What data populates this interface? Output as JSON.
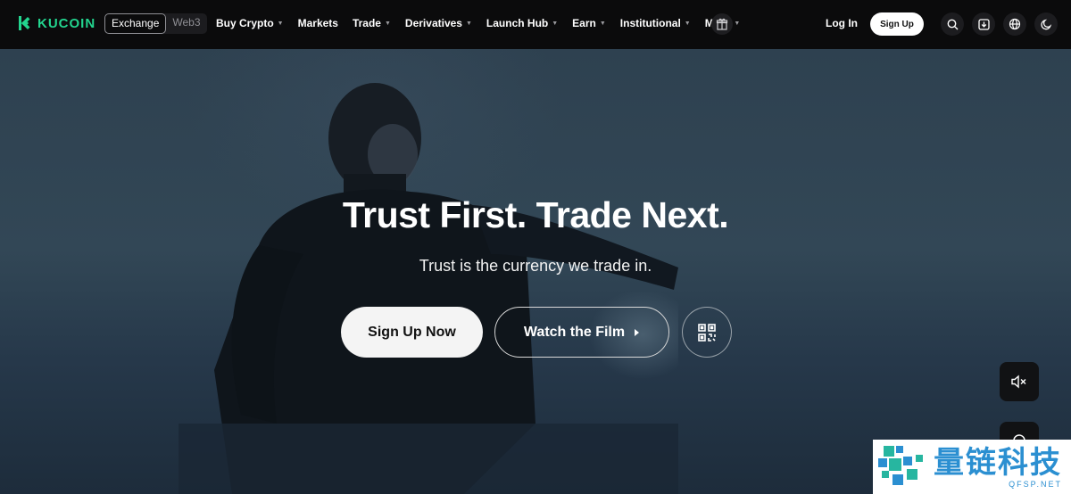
{
  "brand": {
    "name": "KUCOIN",
    "accent": "#23d58f"
  },
  "mode_switch": {
    "items": [
      {
        "label": "Exchange",
        "active": true
      },
      {
        "label": "Web3",
        "active": false
      }
    ]
  },
  "menu": {
    "items": [
      {
        "label": "Buy Crypto",
        "dropdown": true
      },
      {
        "label": "Markets",
        "dropdown": false
      },
      {
        "label": "Trade",
        "dropdown": true
      },
      {
        "label": "Derivatives",
        "dropdown": true
      },
      {
        "label": "Launch Hub",
        "dropdown": true
      },
      {
        "label": "Earn",
        "dropdown": true
      },
      {
        "label": "Institutional",
        "dropdown": true
      },
      {
        "label": "More",
        "dropdown": true
      }
    ]
  },
  "auth": {
    "login": "Log In",
    "signup": "Sign Up"
  },
  "nav_icons": [
    "search-icon",
    "download-icon",
    "globe-icon",
    "moon-icon"
  ],
  "hero": {
    "title": "Trust First. Trade Next.",
    "subtitle": "Trust is the currency we trade in.",
    "primary_cta": "Sign Up Now",
    "secondary_cta": "Watch the Film"
  },
  "watermark": {
    "cn": "量链科技",
    "url": "QFSP.NET"
  }
}
